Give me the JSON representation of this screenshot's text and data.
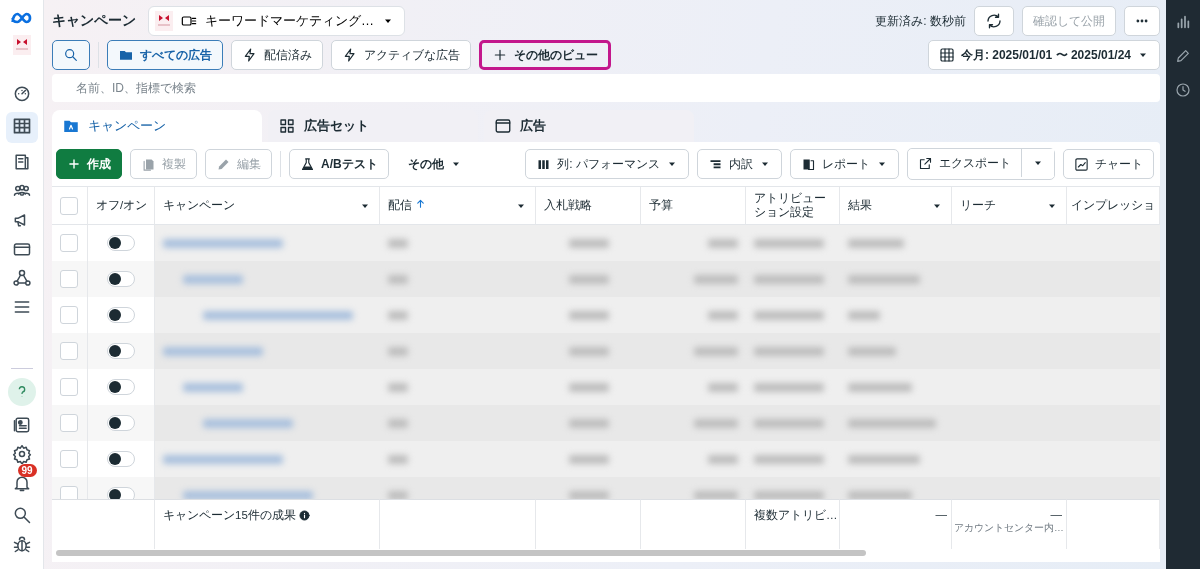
{
  "header": {
    "title": "キャンペーン",
    "account": "キーワードマーケティング…",
    "updated": "更新済み: 数秒前",
    "publish_button": "確認して公開"
  },
  "views": [
    {
      "label": "すべての広告",
      "kind": "folder",
      "selected": true,
      "highlighted": false
    },
    {
      "label": "配信済み",
      "kind": "bolt",
      "selected": false,
      "highlighted": false
    },
    {
      "label": "アクティブな広告",
      "kind": "bolt",
      "selected": false,
      "highlighted": false
    },
    {
      "label": "その他のビュー",
      "kind": "plus",
      "selected": false,
      "highlighted": true
    }
  ],
  "date_range": "今月: 2025/01/01 〜 2025/01/24",
  "search": {
    "placeholder": "名前、ID、指標で検索"
  },
  "tabs": [
    {
      "label": "キャンペーン",
      "kind": "campaign",
      "selected": true
    },
    {
      "label": "広告セット",
      "kind": "adset",
      "selected": false
    },
    {
      "label": "広告",
      "kind": "ad",
      "selected": false
    }
  ],
  "actions": [
    {
      "label": "作成",
      "kind": "create",
      "disabled": false
    },
    {
      "label": "複製",
      "kind": "copy",
      "disabled": true
    },
    {
      "label": "編集",
      "kind": "edit",
      "disabled": true
    },
    {
      "label": "A/Bテスト",
      "kind": "abtest",
      "disabled": false
    },
    {
      "label": "その他",
      "kind": "more",
      "disabled": false
    }
  ],
  "tools": [
    {
      "label": "列: パフォーマンス",
      "kind": "columns"
    },
    {
      "label": "内訳",
      "kind": "breakdown"
    },
    {
      "label": "レポート",
      "kind": "report"
    },
    {
      "label": "エクスポート",
      "kind": "export"
    },
    {
      "label": "チャート",
      "kind": "chart"
    }
  ],
  "table": {
    "select_all_checked": false,
    "columns": [
      {
        "label": "オフ/オン",
        "dropdown": false,
        "sorted": false
      },
      {
        "label": "キャンペーン",
        "dropdown": true,
        "sorted": false
      },
      {
        "label": "配信",
        "dropdown": true,
        "sorted": true
      },
      {
        "label": "入札戦略",
        "dropdown": false,
        "sorted": false
      },
      {
        "label": "予算",
        "dropdown": false,
        "sorted": false
      },
      {
        "label": "アトリビューション設定",
        "dropdown": false,
        "sorted": false
      },
      {
        "label": "結果",
        "dropdown": true,
        "sorted": false
      },
      {
        "label": "リーチ",
        "dropdown": true,
        "sorted": false
      },
      {
        "label": "インプレッショ",
        "dropdown": false,
        "sorted": false
      }
    ],
    "rows": [
      {
        "on": false,
        "checked": false
      },
      {
        "on": false,
        "checked": false
      },
      {
        "on": false,
        "checked": false
      },
      {
        "on": false,
        "checked": false
      },
      {
        "on": false,
        "checked": false
      },
      {
        "on": false,
        "checked": false
      },
      {
        "on": false,
        "checked": false
      },
      {
        "on": false,
        "checked": false
      }
    ],
    "footer": {
      "summary": "キャンペーン15件の成果",
      "attribution": "複数アトリビ…",
      "results": "—",
      "reach": "—",
      "reach_note": "アカウントセンター内…"
    }
  },
  "notifications": {
    "badge": "99"
  }
}
